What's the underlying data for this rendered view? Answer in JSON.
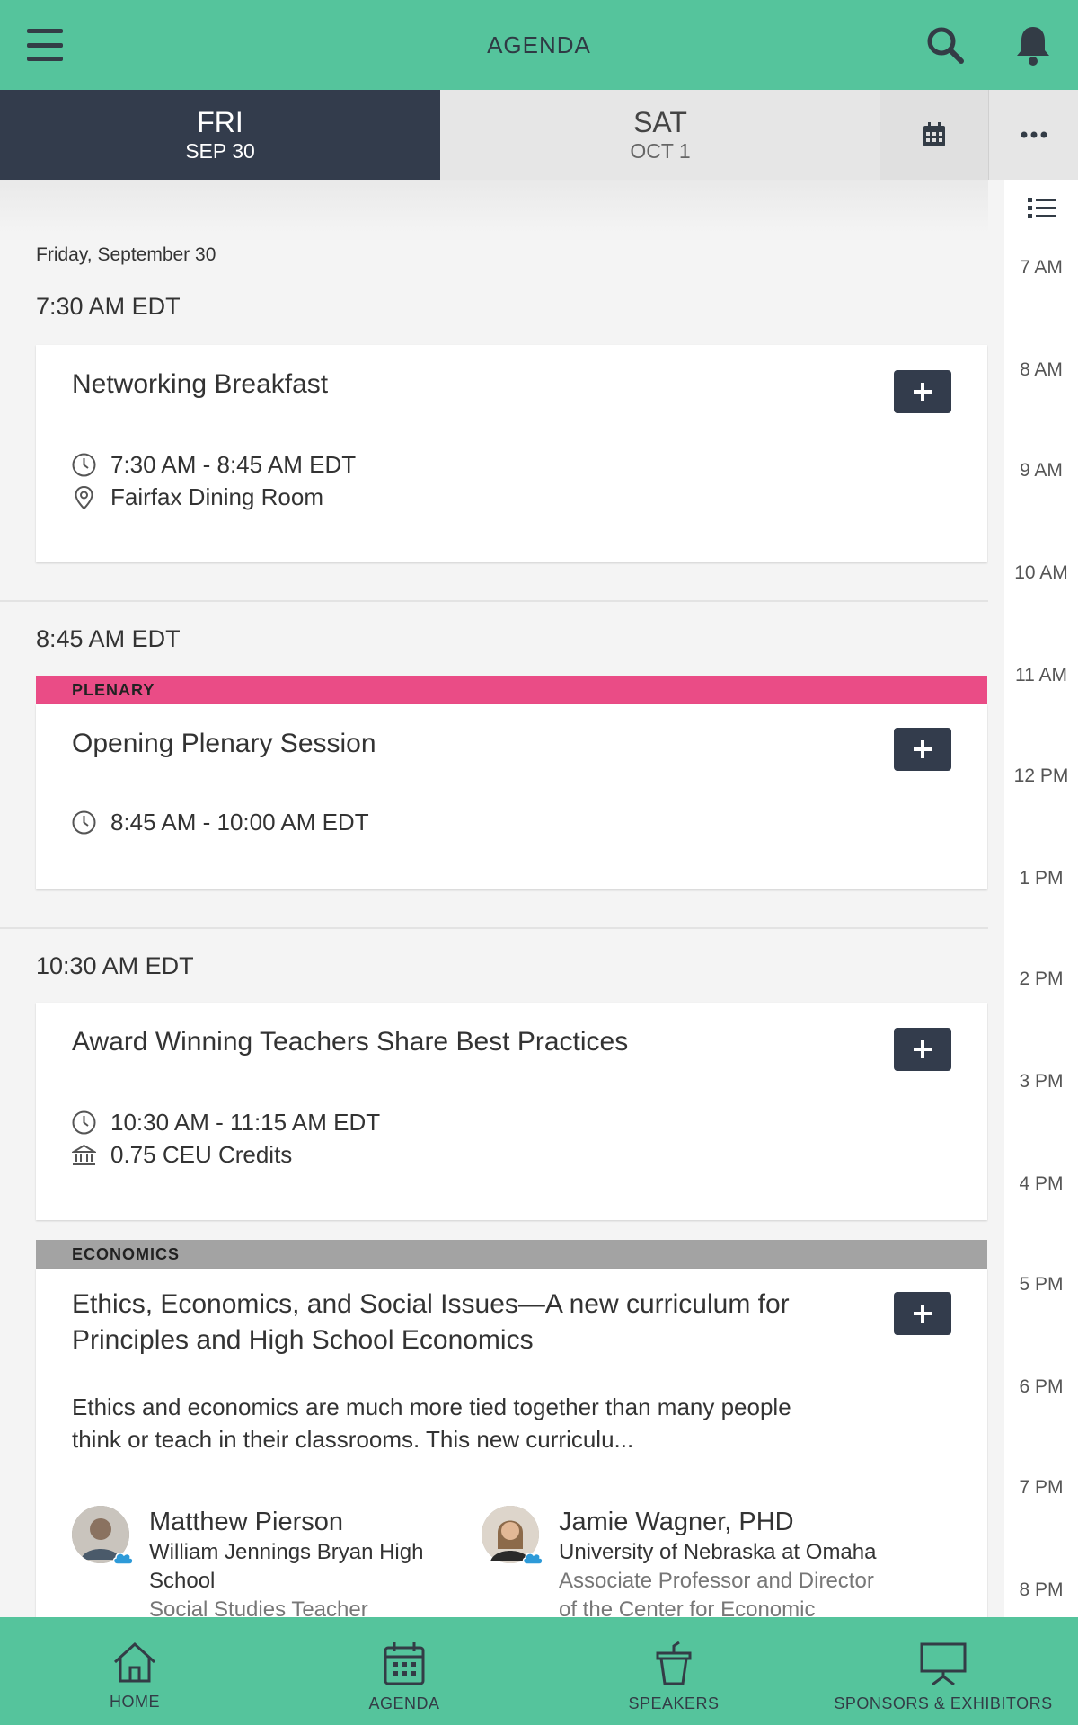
{
  "header": {
    "title": "AGENDA"
  },
  "day_tabs": [
    {
      "dow": "FRI",
      "date": "SEP 30"
    },
    {
      "dow": "SAT",
      "date": "OCT 1"
    }
  ],
  "date_heading": "Friday, September 30",
  "time_headings": [
    "7:30 AM EDT",
    "8:45 AM EDT",
    "10:30 AM EDT"
  ],
  "sessions": [
    {
      "title": "Networking Breakfast",
      "time": "7:30 AM - 8:45 AM EDT",
      "location": "Fairfax Dining Room"
    },
    {
      "track": "PLENARY",
      "track_color": "#ea4c86",
      "title": "Opening Plenary Session",
      "time": "8:45 AM - 10:00 AM EDT"
    },
    {
      "title": "Award Winning Teachers Share Best Practices",
      "time": "10:30 AM - 11:15 AM EDT",
      "credits": "0.75 CEU Credits"
    },
    {
      "track": "ECONOMICS",
      "track_color": "#a3a3a3",
      "title_line1": "Ethics, Economics, and Social Issues—A new curriculum for",
      "title_line2": "Principles and High School Economics",
      "desc_line1": "Ethics and economics are much more tied together than many people",
      "desc_line2": "think or teach in their classrooms. This new curriculu...",
      "speakers": [
        {
          "name": "Matthew Pierson",
          "org_line1": "William Jennings Bryan High",
          "org_line2": "School",
          "role": "Social Studies Teacher"
        },
        {
          "name": "Jamie Wagner, PHD",
          "org_line1": "University of Nebraska at Omaha",
          "role_line1": "Associate Professor and Director",
          "role_line2": "of the Center for Economic"
        }
      ]
    }
  ],
  "timeline_hours": [
    "7 AM",
    "8 AM",
    "9 AM",
    "10 AM",
    "11 AM",
    "12 PM",
    "1 PM",
    "2 PM",
    "3 PM",
    "4 PM",
    "5 PM",
    "6 PM",
    "7 PM",
    "8 PM"
  ],
  "bottom_nav": [
    {
      "label": "HOME",
      "icon": "home-icon"
    },
    {
      "label": "AGENDA",
      "icon": "calendar-icon"
    },
    {
      "label": "SPEAKERS",
      "icon": "podium-icon"
    },
    {
      "label": "SPONSORS & EXHIBITORS",
      "icon": "presentation-board-icon"
    }
  ],
  "colors": {
    "brand": "#55c49c",
    "dark": "#333c4c",
    "plenary": "#ea4c86",
    "economics": "#a3a3a3"
  }
}
